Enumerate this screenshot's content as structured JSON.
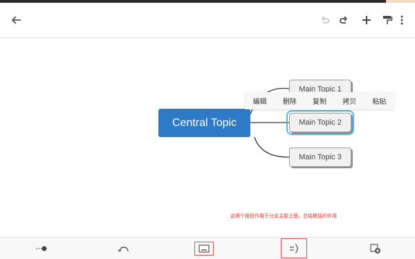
{
  "toolbar": {
    "back_icon": "arrow-left-icon",
    "undo_icon": "undo-icon",
    "redo_icon": "redo-icon",
    "add_icon": "plus-icon",
    "format_icon": "paint-roller-icon",
    "more_icon": "more-vertical-icon"
  },
  "mindmap": {
    "central_topic": "Central Topic",
    "topics": [
      {
        "label": "Main Topic 1",
        "selected": false
      },
      {
        "label": "Main Topic 2",
        "selected": true
      },
      {
        "label": "Main Topic 3",
        "selected": false
      }
    ]
  },
  "context_menu": {
    "items": [
      "编辑",
      "删除",
      "复制",
      "拷贝",
      "粘贴"
    ]
  },
  "annotation": {
    "text": "这两个按钮作用于分支主题上面，总结概括的作用"
  },
  "bottom_bar": {
    "icons": [
      "relationship-icon",
      "boundary-icon",
      "summary-icon",
      "summary-bracket-icon",
      "insert-icon"
    ]
  },
  "colors": {
    "central_fill": "#2e7ac6",
    "selection_outline": "#4fb6e8",
    "annotation_red": "#e03131",
    "highlight_box": "#e05050"
  }
}
